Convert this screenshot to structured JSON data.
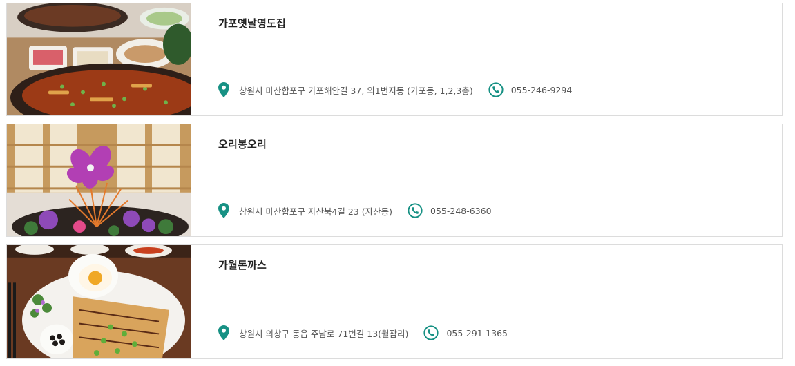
{
  "accent_color": "#179184",
  "restaurants": [
    {
      "name": "가포옛날영도집",
      "address": "창원시 마산합포구 가포해안길 37, 외1번지동 (가포동, 1,2,3층)",
      "phone": "055-246-9294",
      "photo": "grilled-eel-platter-photo"
    },
    {
      "name": "오리봉오리",
      "address": "창원시 마산합포구 자산북4길 23 (자산동)",
      "phone": "055-248-6360",
      "photo": "duck-dish-with-orchid-photo"
    },
    {
      "name": "가월돈까스",
      "address": "창원시 의창구 동읍 주남로 71번길 13(월잠리)",
      "phone": "055-291-1365",
      "photo": "pork-cutlet-plate-photo"
    }
  ]
}
